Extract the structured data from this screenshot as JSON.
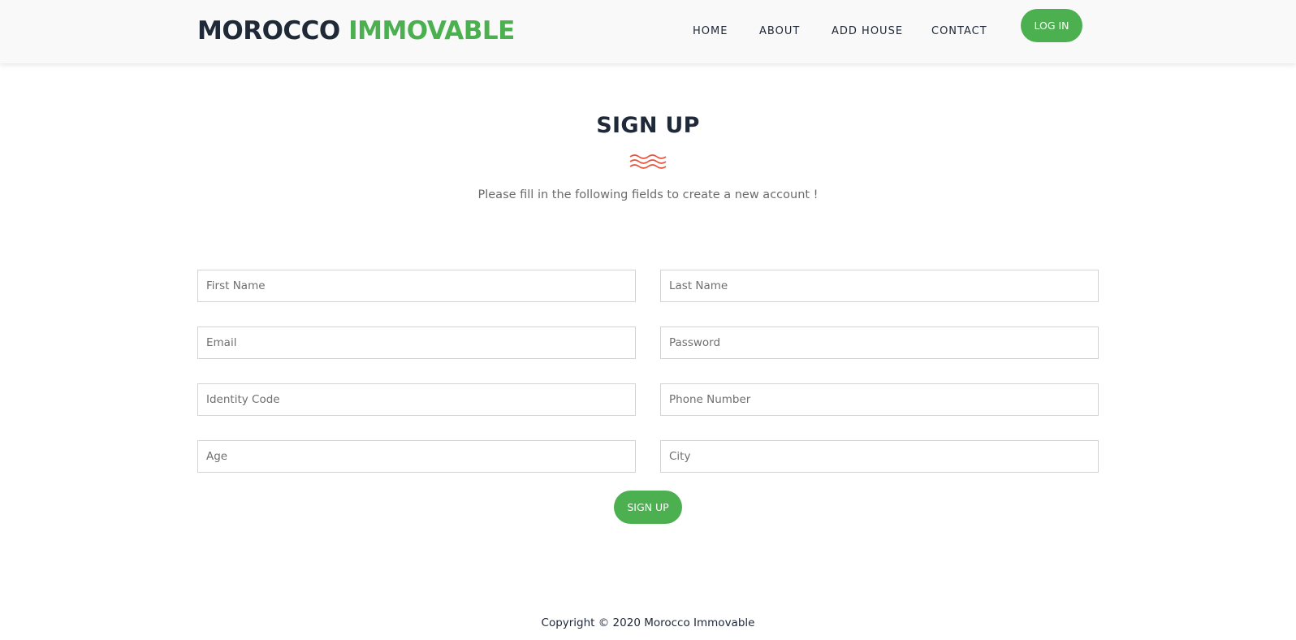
{
  "brand": {
    "part1": "MOROCCO",
    "part2": "IMMOVABLE"
  },
  "nav": {
    "items": [
      {
        "label": "HOME"
      },
      {
        "label": "ABOUT"
      },
      {
        "label": "ADD HOUSE"
      },
      {
        "label": "CONTACT"
      }
    ],
    "login_label": "LOG IN"
  },
  "form": {
    "title": "SIGN UP",
    "subtitle": "Please fill in the following fields to create a new account !",
    "fields": [
      {
        "placeholder": "First Name",
        "value": ""
      },
      {
        "placeholder": "Last Name",
        "value": ""
      },
      {
        "placeholder": "Email",
        "value": ""
      },
      {
        "placeholder": "Password",
        "value": ""
      },
      {
        "placeholder": "Identity Code",
        "value": ""
      },
      {
        "placeholder": "Phone Number",
        "value": ""
      },
      {
        "placeholder": "Age",
        "value": ""
      },
      {
        "placeholder": "City",
        "value": ""
      }
    ],
    "submit_label": "SIGN UP"
  },
  "footer": {
    "copyright": "Copyright © 2020 Morocco Immovable"
  },
  "colors": {
    "accent": "#4caf50",
    "heading": "#1f2937",
    "divider": "#e5533d"
  },
  "icons": {
    "divider": "wave-divider-icon"
  }
}
